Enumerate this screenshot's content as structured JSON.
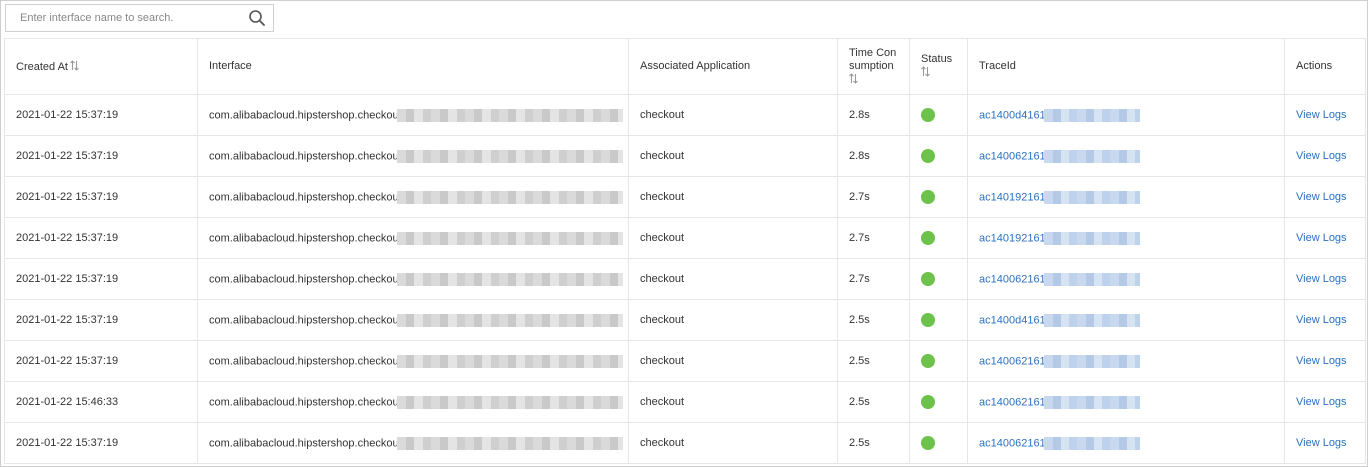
{
  "search": {
    "placeholder": "Enter interface name to search."
  },
  "columns": {
    "created_at": "Created At",
    "interface": "Interface",
    "app": "Associated Application",
    "time": "Time Consumption",
    "status": "Status",
    "traceid": "TraceId",
    "actions": "Actions"
  },
  "colors": {
    "status_ok": "#6dc24b",
    "link": "#2b71c2"
  },
  "rows": [
    {
      "created_at": "2021-01-22 15:37:19",
      "interface": "com.alibabacloud.hipstershop.checkou",
      "app": "checkout",
      "time": "2.8s",
      "status": "success",
      "traceid": "ac1400d4161",
      "action": "View Logs"
    },
    {
      "created_at": "2021-01-22 15:37:19",
      "interface": "com.alibabacloud.hipstershop.checkou",
      "app": "checkout",
      "time": "2.8s",
      "status": "success",
      "traceid": "ac140062161",
      "action": "View Logs"
    },
    {
      "created_at": "2021-01-22 15:37:19",
      "interface": "com.alibabacloud.hipstershop.checkou",
      "app": "checkout",
      "time": "2.7s",
      "status": "success",
      "traceid": "ac140192161",
      "action": "View Logs"
    },
    {
      "created_at": "2021-01-22 15:37:19",
      "interface": "com.alibabacloud.hipstershop.checkou",
      "app": "checkout",
      "time": "2.7s",
      "status": "success",
      "traceid": "ac140192161",
      "action": "View Logs"
    },
    {
      "created_at": "2021-01-22 15:37:19",
      "interface": "com.alibabacloud.hipstershop.checkou",
      "app": "checkout",
      "time": "2.7s",
      "status": "success",
      "traceid": "ac140062161",
      "action": "View Logs"
    },
    {
      "created_at": "2021-01-22 15:37:19",
      "interface": "com.alibabacloud.hipstershop.checkou",
      "app": "checkout",
      "time": "2.5s",
      "status": "success",
      "traceid": "ac1400d4161",
      "action": "View Logs"
    },
    {
      "created_at": "2021-01-22 15:37:19",
      "interface": "com.alibabacloud.hipstershop.checkou",
      "app": "checkout",
      "time": "2.5s",
      "status": "success",
      "traceid": "ac140062161",
      "action": "View Logs"
    },
    {
      "created_at": "2021-01-22 15:46:33",
      "interface": "com.alibabacloud.hipstershop.checkou",
      "app": "checkout",
      "time": "2.5s",
      "status": "success",
      "traceid": "ac140062161",
      "action": "View Logs"
    },
    {
      "created_at": "2021-01-22 15:37:19",
      "interface": "com.alibabacloud.hipstershop.checkou",
      "app": "checkout",
      "time": "2.5s",
      "status": "success",
      "traceid": "ac140062161",
      "action": "View Logs"
    }
  ]
}
